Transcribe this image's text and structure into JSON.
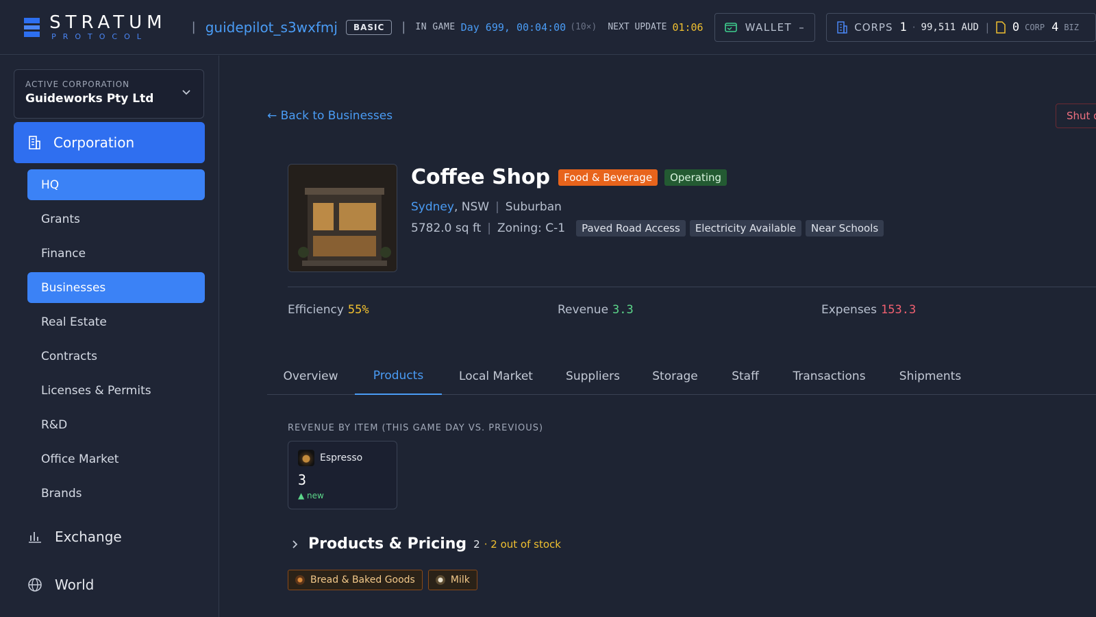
{
  "app": {
    "logo_main": "STRATUM",
    "logo_sub": "PROTOCOL"
  },
  "header": {
    "username": "guidepilot_s3wxfmj",
    "tier": "BASIC",
    "in_game_label": "IN GAME",
    "game_time": "Day 699, 00:04:00",
    "speed": "(10×)",
    "next_update_label": "NEXT UPDATE",
    "next_update": "01:06",
    "wallet_label": "WALLET",
    "wallet_value": "–",
    "corps_label": "CORPS",
    "corps_count": "1",
    "corps_balance": "99,511 AUD",
    "corp_count": "0",
    "corp_label": "CORP",
    "biz_count": "4",
    "biz_label": "BIZ"
  },
  "sidebar": {
    "active_corp_label": "ACTIVE CORPORATION",
    "active_corp": "Guideworks Pty Ltd",
    "section_corporation": "Corporation",
    "items": [
      {
        "label": "HQ"
      },
      {
        "label": "Grants"
      },
      {
        "label": "Finance"
      },
      {
        "label": "Businesses"
      },
      {
        "label": "Real Estate"
      },
      {
        "label": "Contracts"
      },
      {
        "label": "Licenses & Permits"
      },
      {
        "label": "R&D"
      },
      {
        "label": "Office Market"
      },
      {
        "label": "Brands"
      }
    ],
    "section_exchange": "Exchange",
    "section_world": "World"
  },
  "business": {
    "back_label": "← Back to Businesses",
    "shut_label": "Shut down",
    "name": "Coffee Shop",
    "category": "Food & Beverage",
    "status": "Operating",
    "city": "Sydney",
    "state": ", NSW",
    "area_type": "Suburban",
    "size": "5782.0 sq ft",
    "zoning": "Zoning: C-1",
    "features": [
      "Paved Road Access",
      "Electricity Available",
      "Near Schools"
    ],
    "efficiency_label": "Efficiency",
    "efficiency": "55%",
    "revenue_label": "Revenue",
    "revenue": "3.3",
    "expenses_label": "Expenses",
    "expenses": "153.3"
  },
  "tabs": [
    "Overview",
    "Products",
    "Local Market",
    "Suppliers",
    "Storage",
    "Staff",
    "Transactions",
    "Shipments"
  ],
  "products": {
    "revenue_section_label": "REVENUE BY ITEM (THIS GAME DAY VS. PREVIOUS)",
    "item": {
      "name": "Espresso",
      "value": "3",
      "change": "▲ new"
    },
    "pricing_title": "Products & Pricing",
    "pricing_count": "2",
    "out_of_stock": "· 2 out of stock",
    "stock_chips": [
      "Bread & Baked Goods",
      "Milk"
    ]
  },
  "colors": {
    "accent": "#2f6ff0",
    "link": "#4a9cf5",
    "warning": "#f0c030",
    "positive": "#5cd68a",
    "negative": "#f06070",
    "category": "#e8641c"
  }
}
